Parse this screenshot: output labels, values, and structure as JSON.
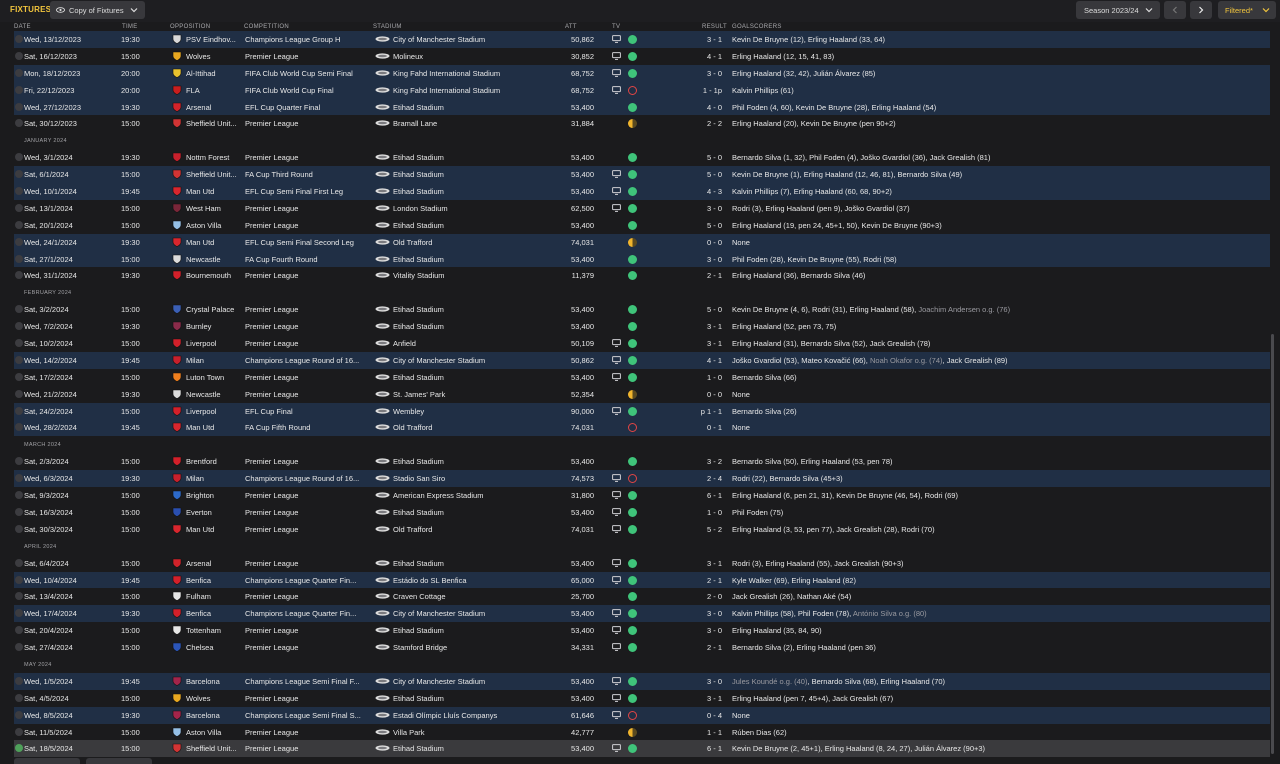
{
  "header": {
    "title": "FIXTURES",
    "view_label": "Copy of Fixtures",
    "season_label": "Season 2023/24",
    "filter_label": "Filtered*"
  },
  "columns": {
    "date": "DATE",
    "time": "TIME",
    "opposition": "OPPOSITION",
    "competition": "COMPETITION",
    "stadium": "STADIUM",
    "att": "ATT",
    "tv": "TV",
    "result": "RESULT",
    "goalscorers": "GOALSCORERS"
  },
  "colors": {
    "accent": "#f2c53d",
    "win": "#3fc47a",
    "draw": "#f1b52d",
    "loss": "#e24545",
    "row_shaded": "#202f45"
  },
  "rows": [
    {
      "kind": "fixture",
      "date": "Wed, 13/12/2023",
      "time": "19:30",
      "opp": "PSV Eindhov...",
      "crest": "#d8d8d8",
      "comp": "Champions League Group H",
      "stadium": "City of Manchester Stadium",
      "att": "50,862",
      "tv": true,
      "res": "w",
      "score": "3 - 1",
      "goals": "Kevin De Bruyne (12), Erling Haaland (33, 64)",
      "shade": true
    },
    {
      "kind": "fixture",
      "date": "Sat, 16/12/2023",
      "time": "15:00",
      "opp": "Wolves",
      "crest": "#e9a820",
      "comp": "Premier League",
      "stadium": "Molineux",
      "att": "30,852",
      "tv": true,
      "res": "w",
      "score": "4 - 1",
      "goals": "Erling Haaland (12, 15, 41, 83)",
      "shade": false
    },
    {
      "kind": "fixture",
      "date": "Mon, 18/12/2023",
      "time": "20:00",
      "opp": "Al-Ittihad",
      "crest": "#e8c22e",
      "comp": "FIFA Club World Cup Semi Final",
      "stadium": "King Fahd International Stadium",
      "att": "68,752",
      "tv": true,
      "res": "w",
      "score": "3 - 0",
      "goals": "Erling Haaland (32, 42), Julián Álvarez (85)",
      "shade": true
    },
    {
      "kind": "fixture",
      "date": "Fri, 22/12/2023",
      "time": "20:00",
      "opp": "FLA",
      "crest": "#c81e1e",
      "comp": "FIFA Club World Cup Final",
      "stadium": "King Fahd International Stadium",
      "att": "68,752",
      "tv": true,
      "res": "l",
      "score": "1 - 1p",
      "goals": "Kalvin Phillips (61)",
      "shade": true
    },
    {
      "kind": "fixture",
      "date": "Wed, 27/12/2023",
      "time": "19:30",
      "opp": "Arsenal",
      "crest": "#d2232a",
      "comp": "EFL Cup Quarter Final",
      "stadium": "Etihad Stadium",
      "att": "53,400",
      "tv": false,
      "res": "w",
      "score": "4 - 0",
      "goals": "Phil Foden (4, 60), Kevin De Bruyne (28), Erling Haaland (54)",
      "shade": true
    },
    {
      "kind": "fixture",
      "date": "Sat, 30/12/2023",
      "time": "15:00",
      "opp": "Sheffield Unit...",
      "crest": "#d23434",
      "comp": "Premier League",
      "stadium": "Bramall Lane",
      "att": "31,884",
      "tv": false,
      "res": "d",
      "score": "2 - 2",
      "goals": "Erling Haaland (20), Kevin De Bruyne (pen 90+2)",
      "shade": false
    },
    {
      "kind": "month",
      "label": "JANUARY 2024"
    },
    {
      "kind": "fixture",
      "date": "Wed, 3/1/2024",
      "time": "19:30",
      "opp": "Nottm Forest",
      "crest": "#c8202c",
      "comp": "Premier League",
      "stadium": "Etihad Stadium",
      "att": "53,400",
      "tv": false,
      "res": "w",
      "score": "5 - 0",
      "goals": "Bernardo Silva (1, 32), Phil Foden (4), Joško Gvardiol (36), Jack Grealish (81)",
      "shade": false
    },
    {
      "kind": "fixture",
      "date": "Sat, 6/1/2024",
      "time": "15:00",
      "opp": "Sheffield Unit...",
      "crest": "#d23434",
      "comp": "FA Cup Third Round",
      "stadium": "Etihad Stadium",
      "att": "53,400",
      "tv": true,
      "res": "w",
      "score": "5 - 0",
      "goals": "Kevin De Bruyne (1), Erling Haaland (12, 46, 81), Bernardo Silva (49)",
      "shade": true
    },
    {
      "kind": "fixture",
      "date": "Wed, 10/1/2024",
      "time": "19:45",
      "opp": "Man Utd",
      "crest": "#d8262e",
      "comp": "EFL Cup Semi Final First Leg",
      "stadium": "Etihad Stadium",
      "att": "53,400",
      "tv": true,
      "res": "w",
      "score": "4 - 3",
      "goals": "Kalvin Phillips (7), Erling Haaland (60, 68, 90+2)",
      "shade": true
    },
    {
      "kind": "fixture",
      "date": "Sat, 13/1/2024",
      "time": "15:00",
      "opp": "West Ham",
      "crest": "#7a2639",
      "comp": "Premier League",
      "stadium": "London Stadium",
      "att": "62,500",
      "tv": true,
      "res": "w",
      "score": "3 - 0",
      "goals": "Rodri (3), Erling Haaland (pen 9), Joško Gvardiol (37)",
      "shade": false
    },
    {
      "kind": "fixture",
      "date": "Sat, 20/1/2024",
      "time": "15:00",
      "opp": "Aston Villa",
      "crest": "#95bfe5",
      "comp": "Premier League",
      "stadium": "Etihad Stadium",
      "att": "53,400",
      "tv": false,
      "res": "w",
      "score": "5 - 0",
      "goals": "Erling Haaland (19, pen 24, 45+1, 50), Kevin De Bruyne (90+3)",
      "shade": false
    },
    {
      "kind": "fixture",
      "date": "Wed, 24/1/2024",
      "time": "19:30",
      "opp": "Man Utd",
      "crest": "#d8262e",
      "comp": "EFL Cup Semi Final Second Leg",
      "stadium": "Old Trafford",
      "att": "74,031",
      "tv": false,
      "res": "d",
      "score": "0 - 0",
      "goals": "None",
      "shade": true
    },
    {
      "kind": "fixture",
      "date": "Sat, 27/1/2024",
      "time": "15:00",
      "opp": "Newcastle",
      "crest": "#dcdcdc",
      "comp": "FA Cup Fourth Round",
      "stadium": "Etihad Stadium",
      "att": "53,400",
      "tv": false,
      "res": "w",
      "score": "3 - 0",
      "goals": "Phil Foden (28), Kevin De Bruyne (55), Rodri (58)",
      "shade": true
    },
    {
      "kind": "fixture",
      "date": "Wed, 31/1/2024",
      "time": "19:30",
      "opp": "Bournemouth",
      "crest": "#d3202a",
      "comp": "Premier League",
      "stadium": "Vitality Stadium",
      "att": "11,379",
      "tv": false,
      "res": "w",
      "score": "2 - 1",
      "goals": "Erling Haaland (36), Bernardo Silva (46)",
      "shade": false
    },
    {
      "kind": "month",
      "label": "FEBRUARY 2024"
    },
    {
      "kind": "fixture",
      "date": "Sat, 3/2/2024",
      "time": "15:00",
      "opp": "Crystal Palace",
      "crest": "#3b5fb5",
      "comp": "Premier League",
      "stadium": "Etihad Stadium",
      "att": "53,400",
      "tv": false,
      "res": "w",
      "score": "5 - 0",
      "goals": "Kevin De Bruyne (4, 6), Rodri (31), Erling Haaland (58), ",
      "og": "Joachim Andersen o.g. (76)",
      "shade": false
    },
    {
      "kind": "fixture",
      "date": "Wed, 7/2/2024",
      "time": "19:30",
      "opp": "Burnley",
      "crest": "#8a2b4a",
      "comp": "Premier League",
      "stadium": "Etihad Stadium",
      "att": "53,400",
      "tv": false,
      "res": "w",
      "score": "3 - 1",
      "goals": "Erling Haaland (52, pen 73, 75)",
      "shade": false
    },
    {
      "kind": "fixture",
      "date": "Sat, 10/2/2024",
      "time": "15:00",
      "opp": "Liverpool",
      "crest": "#d3202a",
      "comp": "Premier League",
      "stadium": "Anfield",
      "att": "50,109",
      "tv": true,
      "res": "w",
      "score": "3 - 1",
      "goals": "Erling Haaland (31), Bernardo Silva (52), Jack Grealish (78)",
      "shade": false
    },
    {
      "kind": "fixture",
      "date": "Wed, 14/2/2024",
      "time": "19:45",
      "opp": "Milan",
      "crest": "#c8202c",
      "comp": "Champions League Round of 16...",
      "stadium": "City of Manchester Stadium",
      "att": "50,862",
      "tv": true,
      "res": "w",
      "score": "4 - 1",
      "goals": "Joško Gvardiol (53), Mateo Kovačić (66), ",
      "og": "Noah Okafor o.g. (74)",
      "goals2": ", Jack Grealish (89)",
      "shade": true
    },
    {
      "kind": "fixture",
      "date": "Sat, 17/2/2024",
      "time": "15:00",
      "opp": "Luton Town",
      "crest": "#f07f1e",
      "comp": "Premier League",
      "stadium": "Etihad Stadium",
      "att": "53,400",
      "tv": true,
      "res": "w",
      "score": "1 - 0",
      "goals": "Bernardo Silva (66)",
      "shade": false
    },
    {
      "kind": "fixture",
      "date": "Wed, 21/2/2024",
      "time": "19:30",
      "opp": "Newcastle",
      "crest": "#dcdcdc",
      "comp": "Premier League",
      "stadium": "St. James' Park",
      "att": "52,354",
      "tv": false,
      "res": "d",
      "score": "0 - 0",
      "goals": "None",
      "shade": false
    },
    {
      "kind": "fixture",
      "date": "Sat, 24/2/2024",
      "time": "15:00",
      "opp": "Liverpool",
      "crest": "#d3202a",
      "comp": "EFL Cup Final",
      "stadium": "Wembley",
      "att": "90,000",
      "tv": true,
      "res": "w",
      "score": "p 1 - 1",
      "goals": "Bernardo Silva (26)",
      "shade": true
    },
    {
      "kind": "fixture",
      "date": "Wed, 28/2/2024",
      "time": "19:45",
      "opp": "Man Utd",
      "crest": "#d8262e",
      "comp": "FA Cup Fifth Round",
      "stadium": "Old Trafford",
      "att": "74,031",
      "tv": false,
      "res": "l",
      "score": "0 - 1",
      "goals": "None",
      "shade": true
    },
    {
      "kind": "month",
      "label": "MARCH 2024"
    },
    {
      "kind": "fixture",
      "date": "Sat, 2/3/2024",
      "time": "15:00",
      "opp": "Brentford",
      "crest": "#d3202a",
      "comp": "Premier League",
      "stadium": "Etihad Stadium",
      "att": "53,400",
      "tv": false,
      "res": "w",
      "score": "3 - 2",
      "goals": "Bernardo Silva (50), Erling Haaland (53, pen 78)",
      "shade": false
    },
    {
      "kind": "fixture",
      "date": "Wed, 6/3/2024",
      "time": "19:30",
      "opp": "Milan",
      "crest": "#c8202c",
      "comp": "Champions League Round of 16...",
      "stadium": "Stadio San Siro",
      "att": "74,573",
      "tv": true,
      "res": "l",
      "score": "2 - 4",
      "goals": "Rodri (22), Bernardo Silva (45+3)",
      "shade": true
    },
    {
      "kind": "fixture",
      "date": "Sat, 9/3/2024",
      "time": "15:00",
      "opp": "Brighton",
      "crest": "#2d6ac9",
      "comp": "Premier League",
      "stadium": "American Express Stadium",
      "att": "31,800",
      "tv": true,
      "res": "w",
      "score": "6 - 1",
      "goals": "Erling Haaland (6, pen 21, 31), Kevin De Bruyne (46, 54), Rodri (69)",
      "shade": false
    },
    {
      "kind": "fixture",
      "date": "Sat, 16/3/2024",
      "time": "15:00",
      "opp": "Everton",
      "crest": "#2a4fb0",
      "comp": "Premier League",
      "stadium": "Etihad Stadium",
      "att": "53,400",
      "tv": true,
      "res": "w",
      "score": "1 - 0",
      "goals": "Phil Foden (75)",
      "shade": false
    },
    {
      "kind": "fixture",
      "date": "Sat, 30/3/2024",
      "time": "15:00",
      "opp": "Man Utd",
      "crest": "#d8262e",
      "comp": "Premier League",
      "stadium": "Old Trafford",
      "att": "74,031",
      "tv": true,
      "res": "w",
      "score": "5 - 2",
      "goals": "Erling Haaland (3, 53, pen 77), Jack Grealish (28), Rodri (70)",
      "shade": false
    },
    {
      "kind": "month",
      "label": "APRIL 2024"
    },
    {
      "kind": "fixture",
      "date": "Sat, 6/4/2024",
      "time": "15:00",
      "opp": "Arsenal",
      "crest": "#d2232a",
      "comp": "Premier League",
      "stadium": "Etihad Stadium",
      "att": "53,400",
      "tv": true,
      "res": "w",
      "score": "3 - 1",
      "goals": "Rodri (3), Erling Haaland (55), Jack Grealish (90+3)",
      "shade": false
    },
    {
      "kind": "fixture",
      "date": "Wed, 10/4/2024",
      "time": "19:45",
      "opp": "Benfica",
      "crest": "#d3202a",
      "comp": "Champions League Quarter Fin...",
      "stadium": "Estádio do SL Benfica",
      "att": "65,000",
      "tv": true,
      "res": "w",
      "score": "2 - 1",
      "goals": "Kyle Walker (69), Erling Haaland (82)",
      "shade": true
    },
    {
      "kind": "fixture",
      "date": "Sat, 13/4/2024",
      "time": "15:00",
      "opp": "Fulham",
      "crest": "#e6e6e6",
      "comp": "Premier League",
      "stadium": "Craven Cottage",
      "att": "25,700",
      "tv": false,
      "res": "w",
      "score": "2 - 0",
      "goals": "Jack Grealish (26), Nathan Aké (54)",
      "shade": false
    },
    {
      "kind": "fixture",
      "date": "Wed, 17/4/2024",
      "time": "19:30",
      "opp": "Benfica",
      "crest": "#d3202a",
      "comp": "Champions League Quarter Fin...",
      "stadium": "City of Manchester Stadium",
      "att": "53,400",
      "tv": true,
      "res": "w",
      "score": "3 - 0",
      "goals": "Kalvin Phillips (58), Phil Foden (78), ",
      "og": "António Silva o.g. (80)",
      "shade": true
    },
    {
      "kind": "fixture",
      "date": "Sat, 20/4/2024",
      "time": "15:00",
      "opp": "Tottenham",
      "crest": "#e6e6e6",
      "comp": "Premier League",
      "stadium": "Etihad Stadium",
      "att": "53,400",
      "tv": true,
      "res": "w",
      "score": "3 - 0",
      "goals": "Erling Haaland (35, 84, 90)",
      "shade": false
    },
    {
      "kind": "fixture",
      "date": "Sat, 27/4/2024",
      "time": "15:00",
      "opp": "Chelsea",
      "crest": "#2b55b8",
      "comp": "Premier League",
      "stadium": "Stamford Bridge",
      "att": "34,331",
      "tv": true,
      "res": "w",
      "score": "2 - 1",
      "goals": "Bernardo Silva (2), Erling Haaland (pen 36)",
      "shade": false
    },
    {
      "kind": "month",
      "label": "MAY 2024"
    },
    {
      "kind": "fixture",
      "date": "Wed, 1/5/2024",
      "time": "19:45",
      "opp": "Barcelona",
      "crest": "#a3244a",
      "comp": "Champions League Semi Final F...",
      "stadium": "City of Manchester Stadium",
      "att": "53,400",
      "tv": true,
      "res": "w",
      "score": "3 - 0",
      "goals": "",
      "og": "Jules Koundé o.g. (40)",
      "goals2": ", Bernardo Silva (68), Erling Haaland (70)",
      "shade": true
    },
    {
      "kind": "fixture",
      "date": "Sat, 4/5/2024",
      "time": "15:00",
      "opp": "Wolves",
      "crest": "#e9a820",
      "comp": "Premier League",
      "stadium": "Etihad Stadium",
      "att": "53,400",
      "tv": true,
      "res": "w",
      "score": "3 - 1",
      "goals": "Erling Haaland (pen 7, 45+4), Jack Grealish (67)",
      "shade": false
    },
    {
      "kind": "fixture",
      "date": "Wed, 8/5/2024",
      "time": "19:30",
      "opp": "Barcelona",
      "crest": "#a3244a",
      "comp": "Champions League Semi Final S...",
      "stadium": "Estadi Olímpic Lluís Companys",
      "att": "61,646",
      "tv": true,
      "res": "l",
      "score": "0 - 4",
      "goals": "None",
      "shade": true
    },
    {
      "kind": "fixture",
      "date": "Sat, 11/5/2024",
      "time": "15:00",
      "opp": "Aston Villa",
      "crest": "#95bfe5",
      "comp": "Premier League",
      "stadium": "Villa Park",
      "att": "42,777",
      "tv": false,
      "res": "d",
      "score": "1 - 1",
      "goals": "Rúben Dias (62)",
      "shade": false
    },
    {
      "kind": "fixture",
      "date": "Sat, 18/5/2024",
      "time": "15:00",
      "opp": "Sheffield Unit...",
      "crest": "#d23434",
      "comp": "Premier League",
      "stadium": "Etihad Stadium",
      "att": "53,400",
      "tv": true,
      "res": "w",
      "score": "6 - 1",
      "goals": "Kevin De Bruyne (2, 45+1), Erling Haaland (8, 24, 27), Julián Álvarez (90+3)",
      "shade": false,
      "last": true
    }
  ]
}
